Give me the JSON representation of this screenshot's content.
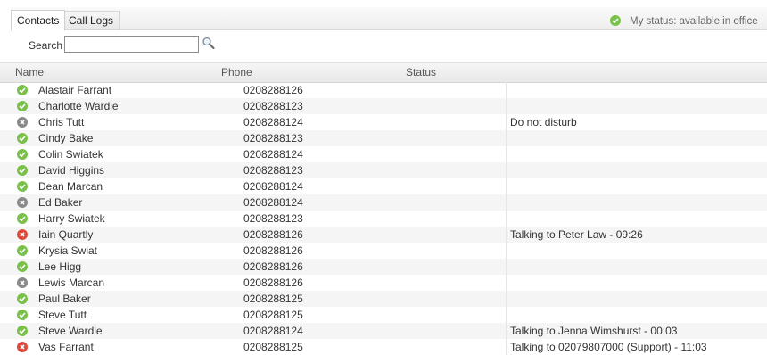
{
  "tabs": [
    {
      "label": "Contacts",
      "active": true
    },
    {
      "label": "Call Logs",
      "active": false
    }
  ],
  "my_status": {
    "text": "My status: available in office",
    "icon": "available-icon",
    "color": "#79c14a"
  },
  "search": {
    "label": "Search",
    "value": "",
    "icon": "magnifier-icon"
  },
  "columns": {
    "name": "Name",
    "phone": "Phone",
    "status": "Status"
  },
  "colors": {
    "available": "#79c14a",
    "dnd": "#8a8a8a",
    "busy": "#e04a3a"
  },
  "contacts": [
    {
      "name": "Alastair Farrant",
      "phone": "0208288126",
      "status": "",
      "state": "available"
    },
    {
      "name": "Charlotte Wardle",
      "phone": "0208288123",
      "status": "",
      "state": "available"
    },
    {
      "name": "Chris Tutt",
      "phone": "0208288124",
      "status": "Do not disturb",
      "state": "dnd"
    },
    {
      "name": "Cindy Bake",
      "phone": "0208288123",
      "status": "",
      "state": "available"
    },
    {
      "name": "Colin Swiatek",
      "phone": "0208288124",
      "status": "",
      "state": "available"
    },
    {
      "name": "David Higgins",
      "phone": "0208288123",
      "status": "",
      "state": "available"
    },
    {
      "name": "Dean Marcan",
      "phone": "0208288124",
      "status": "",
      "state": "available"
    },
    {
      "name": "Ed Baker",
      "phone": "0208288124",
      "status": "",
      "state": "dnd"
    },
    {
      "name": "Harry Swiatek",
      "phone": "0208288123",
      "status": "",
      "state": "available"
    },
    {
      "name": "Iain Quartly",
      "phone": "0208288126",
      "status": "Talking to Peter Law - 09:26",
      "state": "busy"
    },
    {
      "name": "Krysia Swiat",
      "phone": "0208288126",
      "status": "",
      "state": "available"
    },
    {
      "name": "Lee Higg",
      "phone": "0208288126",
      "status": "",
      "state": "available"
    },
    {
      "name": "Lewis Marcan",
      "phone": "0208288126",
      "status": "",
      "state": "dnd"
    },
    {
      "name": "Paul Baker",
      "phone": "0208288125",
      "status": "",
      "state": "available"
    },
    {
      "name": "Steve Tutt",
      "phone": "0208288125",
      "status": "",
      "state": "available"
    },
    {
      "name": "Steve Wardle",
      "phone": "0208288124",
      "status": "Talking to Jenna Wimshurst - 00:03",
      "state": "available"
    },
    {
      "name": "Vas Farrant",
      "phone": "0208288125",
      "status": "Talking to 02079807000 (Support) - 11:03",
      "state": "busy"
    }
  ]
}
